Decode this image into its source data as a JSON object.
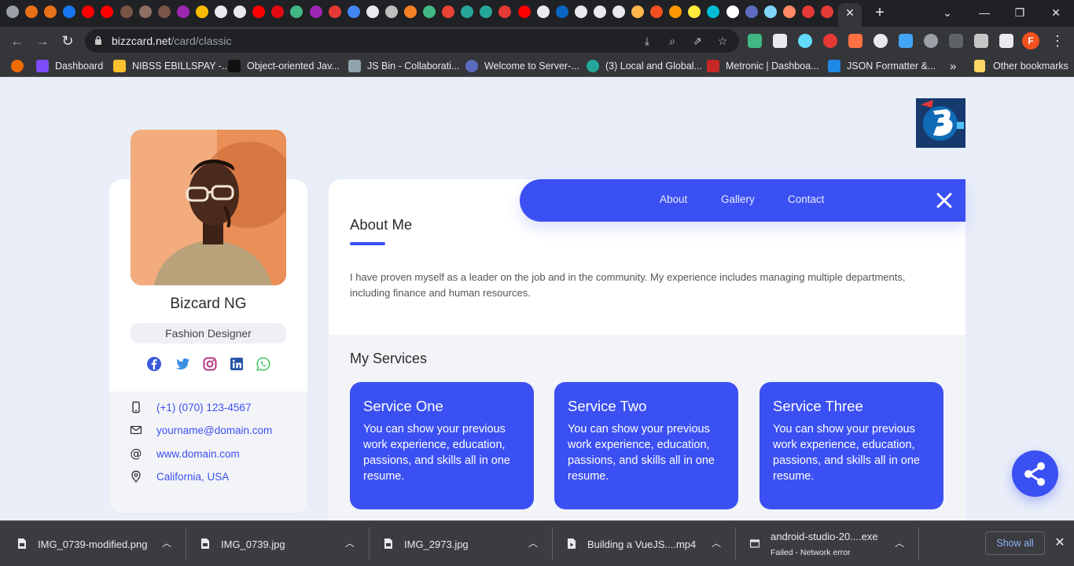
{
  "browser": {
    "favicons": [
      "chrome-icon",
      "figma-icon",
      "figma-icon",
      "facebook-icon",
      "youtube-icon",
      "youtube-icon",
      "book-icon",
      "avatar-icon",
      "book-icon",
      "music-icon",
      "chrome-icon",
      "github-icon",
      "github-icon",
      "youtube-icon",
      "netflix-icon",
      "vue-icon",
      "music-icon",
      "news-icon",
      "google-icon",
      "github-icon",
      "box-icon",
      "stack-icon",
      "vue-icon",
      "gmail-icon",
      "diamond-icon",
      "diamond-icon",
      "pinterest-icon",
      "youtube-icon",
      "home-icon",
      "linkedin-icon",
      "globe-icon",
      "globe-icon",
      "home-icon",
      "cart-icon",
      "microsoft-icon",
      "photos-icon",
      "photos-icon",
      "c-icon",
      "io-icon",
      "shield-icon",
      "wave-icon",
      "monkey-icon",
      "pinterest-icon",
      "pinterest-icon",
      "c-icon"
    ],
    "new_tab_glyph": "+",
    "url_host": "bizzcard.net",
    "url_path": "/card/classic",
    "profile_initial": "F",
    "bookmarks": [
      {
        "label": "",
        "icon": "apps-icon"
      },
      {
        "label": "Dashboard",
        "icon": "logo-icon"
      },
      {
        "label": "NIBSS EBILLSPAY -...",
        "icon": "bank-icon"
      },
      {
        "label": "Object-oriented Jav...",
        "icon": "m-icon"
      },
      {
        "label": "JS Bin - Collaborati...",
        "icon": "jsbin-icon"
      },
      {
        "label": "Welcome to Server-...",
        "icon": "link-icon"
      },
      {
        "label": "(3) Local and Global...",
        "icon": "check-icon"
      },
      {
        "label": "Metronic | Dashboa...",
        "icon": "metronic-icon"
      },
      {
        "label": "JSON Formatter &...",
        "icon": "checkbox-icon"
      }
    ],
    "more_bookmarks": "»",
    "other_bookmarks": "Other bookmarks"
  },
  "profile": {
    "name": "Bizcard NG",
    "role": "Fashion Designer",
    "socials": [
      "facebook-icon",
      "twitter-icon",
      "instagram-icon",
      "linkedin-icon",
      "whatsapp-icon"
    ],
    "contacts": [
      {
        "icon": "phone-icon",
        "text": "(+1) (070) 123-4567"
      },
      {
        "icon": "mail-icon",
        "text": "yourname@domain.com"
      },
      {
        "icon": "at-icon",
        "text": "www.domain.com"
      },
      {
        "icon": "location-icon",
        "text": "California, USA"
      }
    ]
  },
  "nav": {
    "links": [
      "About",
      "Gallery",
      "Contact"
    ],
    "close_icon": "close-icon"
  },
  "about": {
    "title": "About Me",
    "text": "I have proven myself as a leader on the job and in the community. My experience includes managing multiple departments, including finance and human resources."
  },
  "services": {
    "title": "My Services",
    "items": [
      {
        "name": "Service One",
        "desc": "You can show your previous work experience, education, passions, and skills all in one resume."
      },
      {
        "name": "Service Two",
        "desc": "You can show your previous work experience, education, passions, and skills all in one resume."
      },
      {
        "name": "Service Three",
        "desc": "You can show your previous work experience, education, passions, and skills all in one resume."
      }
    ]
  },
  "downloads": {
    "items": [
      {
        "name": "IMG_0739-modified.png",
        "status": "",
        "icon": "image-file-icon"
      },
      {
        "name": "IMG_0739.jpg",
        "status": "",
        "icon": "image-file-icon"
      },
      {
        "name": "IMG_2973.jpg",
        "status": "",
        "icon": "image-file-icon"
      },
      {
        "name": "Building a VueJS....mp4",
        "status": "",
        "icon": "video-file-icon"
      },
      {
        "name": "android-studio-20....exe",
        "status": "Failed - Network error",
        "icon": "exe-file-icon"
      }
    ],
    "show_all": "Show all"
  },
  "colors": {
    "accent": "#3b50f3",
    "page_bg": "#e9eef8",
    "chrome_dark": "#202124",
    "chrome_toolbar": "#35363a",
    "photo_orange": "#e78a52"
  }
}
